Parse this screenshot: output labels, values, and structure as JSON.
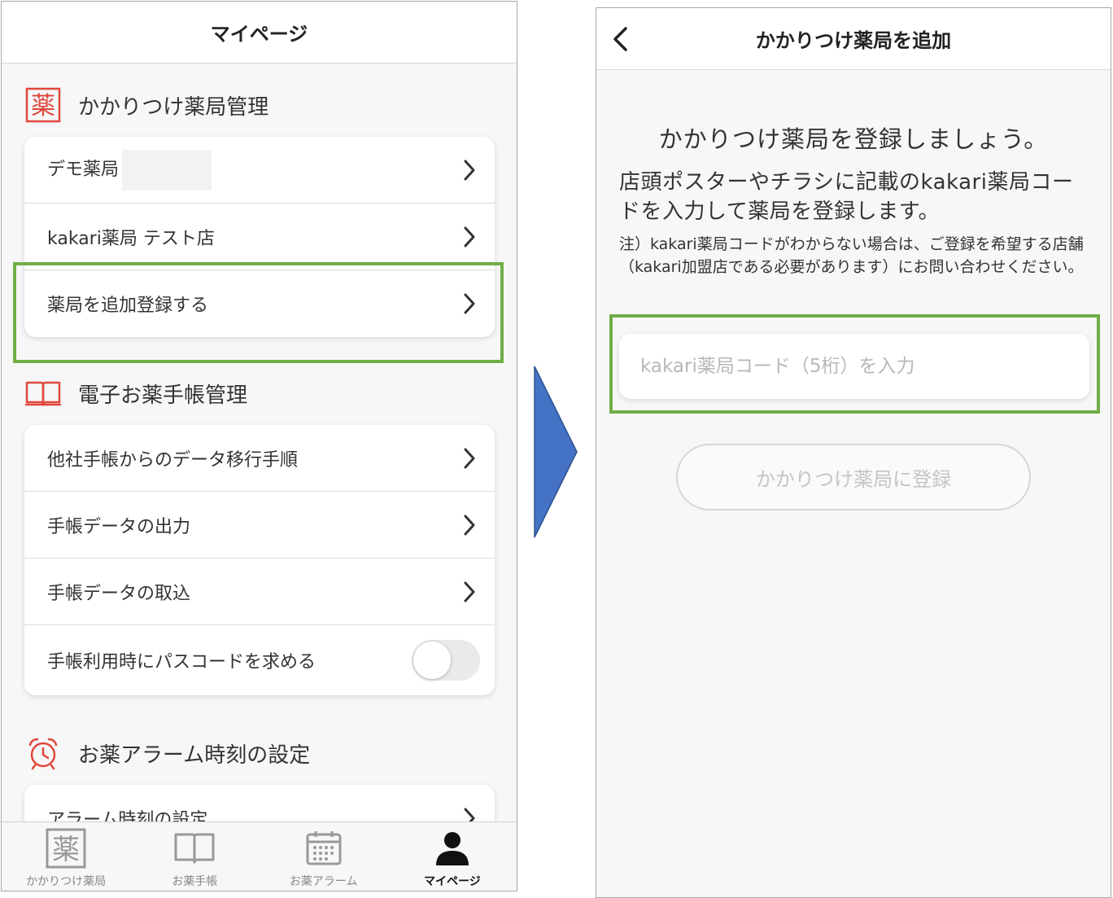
{
  "left": {
    "title": "マイページ",
    "pharmacy_section": {
      "heading": "かかりつけ薬局管理",
      "icon_char": "薬",
      "items": [
        {
          "label": "デモ薬局"
        },
        {
          "label": "kakari薬局 テスト店"
        },
        {
          "label": "薬局を追加登録する"
        }
      ]
    },
    "notebook_section": {
      "heading": "電子お薬手帳管理",
      "items": [
        {
          "label": "他社手帳からのデータ移行手順"
        },
        {
          "label": "手帳データの出力"
        },
        {
          "label": "手帳データの取込"
        },
        {
          "label": "手帳利用時にパスコードを求める",
          "toggle_on": false
        }
      ]
    },
    "alarm_section": {
      "heading": "お薬アラーム時刻の設定",
      "items": [
        {
          "label": "アラーム時刻の設定"
        }
      ]
    },
    "tabs": [
      {
        "label": "かかりつけ薬局",
        "icon_char": "薬",
        "active": false
      },
      {
        "label": "お薬手帳",
        "active": false
      },
      {
        "label": "お薬アラーム",
        "active": false
      },
      {
        "label": "マイページ",
        "active": true
      }
    ]
  },
  "right": {
    "title": "かかりつけ薬局を追加",
    "headline": "かかりつけ薬局を登録しましょう。",
    "description": "店頭ポスターやチラシに記載のkakari薬局コードを入力して薬局を登録します。",
    "note": "注）kakari薬局コードがわからない場合は、ご登録を希望する店舗（kakari加盟店である必要があります）にお問い合わせください。",
    "code_input_placeholder": "kakari薬局コード（5桁）を入力",
    "code_input_value": "",
    "register_button_label": "かかりつけ薬局に登録"
  },
  "colors": {
    "highlight": "#70ad47",
    "accent_red": "#e0473c",
    "arrow_blue": "#4472c4"
  }
}
